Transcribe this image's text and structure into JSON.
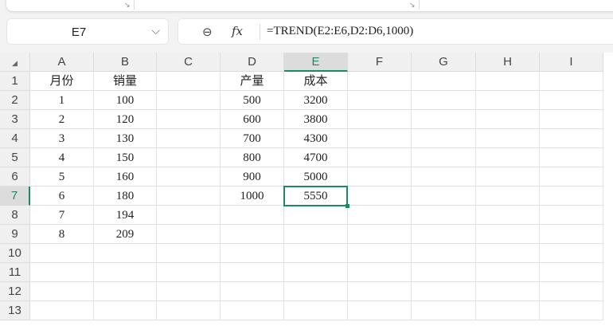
{
  "name_box": {
    "ref": "E7"
  },
  "formula_bar": {
    "formula": "=TREND(E2:E6,D2:D6,1000)",
    "fx_label": "fx"
  },
  "columns": [
    "A",
    "B",
    "C",
    "D",
    "E",
    "F",
    "G",
    "H",
    "I"
  ],
  "rows": [
    "1",
    "2",
    "3",
    "4",
    "5",
    "6",
    "7",
    "8",
    "9",
    "10",
    "11",
    "12",
    "13"
  ],
  "selected": {
    "col": "E",
    "row": "7"
  },
  "cells": {
    "A1": "月份",
    "B1": "销量",
    "D1": "产量",
    "E1": "成本",
    "A2": "1",
    "B2": "100",
    "D2": "500",
    "E2": "3200",
    "A3": "2",
    "B3": "120",
    "D3": "600",
    "E3": "3800",
    "A4": "3",
    "B4": "130",
    "D4": "700",
    "E4": "4300",
    "A5": "4",
    "B5": "150",
    "D5": "800",
    "E5": "4700",
    "A6": "5",
    "B6": "160",
    "D6": "900",
    "E6": "5000",
    "A7": "6",
    "B7": "180",
    "D7": "1000",
    "E7": "5550",
    "A8": "7",
    "B8": "194",
    "A9": "8",
    "B9": "209"
  },
  "colors": {
    "accent": "#1a8a5f"
  }
}
